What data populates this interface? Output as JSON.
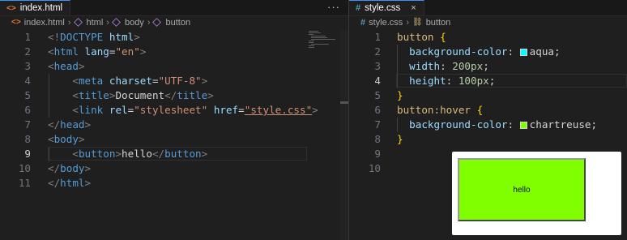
{
  "left": {
    "tab": {
      "icon": "html-file-icon",
      "label": "index.html",
      "close": "×"
    },
    "more": "···",
    "breadcrumb": [
      "index.html",
      "html",
      "body",
      "button"
    ],
    "lines": [
      {
        "n": "1",
        "tokens": [
          [
            "c-punct",
            "<!"
          ],
          [
            "c-tag",
            "DOCTYPE"
          ],
          [
            "c-text",
            " "
          ],
          [
            "c-attr",
            "html"
          ],
          [
            "c-punct",
            ">"
          ]
        ]
      },
      {
        "n": "2",
        "tokens": [
          [
            "c-punct",
            "<"
          ],
          [
            "c-tag",
            "html"
          ],
          [
            "c-text",
            " "
          ],
          [
            "c-attr",
            "lang"
          ],
          [
            "c-text",
            "="
          ],
          [
            "c-str",
            "\"en\""
          ],
          [
            "c-punct",
            ">"
          ]
        ]
      },
      {
        "n": "3",
        "tokens": [
          [
            "c-punct",
            "<"
          ],
          [
            "c-tag",
            "head"
          ],
          [
            "c-punct",
            ">"
          ]
        ]
      },
      {
        "n": "4",
        "tokens": [
          [
            "c-text",
            "    "
          ],
          [
            "c-punct",
            "<"
          ],
          [
            "c-tag",
            "meta"
          ],
          [
            "c-text",
            " "
          ],
          [
            "c-attr",
            "charset"
          ],
          [
            "c-text",
            "="
          ],
          [
            "c-str",
            "\"UTF-8\""
          ],
          [
            "c-punct",
            ">"
          ]
        ]
      },
      {
        "n": "5",
        "tokens": [
          [
            "c-text",
            "    "
          ],
          [
            "c-punct",
            "<"
          ],
          [
            "c-tag",
            "title"
          ],
          [
            "c-punct",
            ">"
          ],
          [
            "c-text",
            "Document"
          ],
          [
            "c-punct",
            "</"
          ],
          [
            "c-tag",
            "title"
          ],
          [
            "c-punct",
            ">"
          ]
        ]
      },
      {
        "n": "6",
        "tokens": [
          [
            "c-text",
            "    "
          ],
          [
            "c-punct",
            "<"
          ],
          [
            "c-tag",
            "link"
          ],
          [
            "c-text",
            " "
          ],
          [
            "c-attr",
            "rel"
          ],
          [
            "c-text",
            "="
          ],
          [
            "c-str",
            "\"stylesheet\""
          ],
          [
            "c-text",
            " "
          ],
          [
            "c-attr",
            "href"
          ],
          [
            "c-text",
            "="
          ],
          [
            "c-link",
            "\"style.css\""
          ],
          [
            "c-punct",
            ">"
          ]
        ]
      },
      {
        "n": "7",
        "tokens": [
          [
            "c-punct",
            "</"
          ],
          [
            "c-tag",
            "head"
          ],
          [
            "c-punct",
            ">"
          ]
        ]
      },
      {
        "n": "8",
        "tokens": [
          [
            "c-punct",
            "<"
          ],
          [
            "c-tag",
            "body"
          ],
          [
            "c-punct",
            ">"
          ]
        ]
      },
      {
        "n": "9",
        "tokens": [
          [
            "c-text",
            "    "
          ],
          [
            "c-punct",
            "<"
          ],
          [
            "c-tag",
            "button"
          ],
          [
            "c-punct",
            ">"
          ],
          [
            "c-text",
            "hello"
          ],
          [
            "c-punct",
            "</"
          ],
          [
            "c-tag",
            "button"
          ],
          [
            "c-punct",
            ">"
          ]
        ],
        "active": true
      },
      {
        "n": "10",
        "tokens": [
          [
            "c-punct",
            "</"
          ],
          [
            "c-tag",
            "body"
          ],
          [
            "c-punct",
            ">"
          ]
        ]
      },
      {
        "n": "11",
        "tokens": [
          [
            "c-punct",
            "</"
          ],
          [
            "c-tag",
            "html"
          ],
          [
            "c-punct",
            ">"
          ]
        ]
      }
    ]
  },
  "right": {
    "tab": {
      "icon": "css-file-icon",
      "label": "style.css",
      "close": "×"
    },
    "breadcrumb": [
      "style.css",
      "button"
    ],
    "lines": [
      {
        "n": "1",
        "tokens": [
          [
            "c-sel",
            "button"
          ],
          [
            "c-text",
            " "
          ],
          [
            "c-brace",
            "{"
          ]
        ]
      },
      {
        "n": "2",
        "tokens": [
          [
            "c-text",
            "  "
          ],
          [
            "c-prop",
            "background-color"
          ],
          [
            "c-text",
            ": "
          ],
          [
            "swatch",
            "#00ffff"
          ],
          [
            "c-val",
            "aqua"
          ],
          [
            "c-text",
            ";"
          ]
        ]
      },
      {
        "n": "3",
        "tokens": [
          [
            "c-text",
            "  "
          ],
          [
            "c-prop",
            "width"
          ],
          [
            "c-text",
            ": "
          ],
          [
            "c-num",
            "200px"
          ],
          [
            "c-text",
            ";"
          ]
        ]
      },
      {
        "n": "4",
        "tokens": [
          [
            "c-text",
            "  "
          ],
          [
            "c-prop",
            "height"
          ],
          [
            "c-text",
            ": "
          ],
          [
            "c-num",
            "100px"
          ],
          [
            "c-text",
            ";"
          ]
        ],
        "active": true
      },
      {
        "n": "5",
        "tokens": [
          [
            "c-brace",
            "}"
          ]
        ]
      },
      {
        "n": "6",
        "tokens": [
          [
            "c-sel",
            "button:hover"
          ],
          [
            "c-text",
            " "
          ],
          [
            "c-brace",
            "{"
          ]
        ]
      },
      {
        "n": "7",
        "tokens": [
          [
            "c-text",
            "  "
          ],
          [
            "c-prop",
            "background-color"
          ],
          [
            "c-text",
            ": "
          ],
          [
            "swatch",
            "#7fff00"
          ],
          [
            "c-val",
            "chartreuse"
          ],
          [
            "c-text",
            ";"
          ]
        ]
      },
      {
        "n": "8",
        "tokens": [
          [
            "c-brace",
            "}"
          ]
        ]
      },
      {
        "n": "9",
        "tokens": []
      },
      {
        "n": "10",
        "tokens": []
      }
    ]
  },
  "preview": {
    "button_label": "hello",
    "button_color": "#7fff00"
  }
}
